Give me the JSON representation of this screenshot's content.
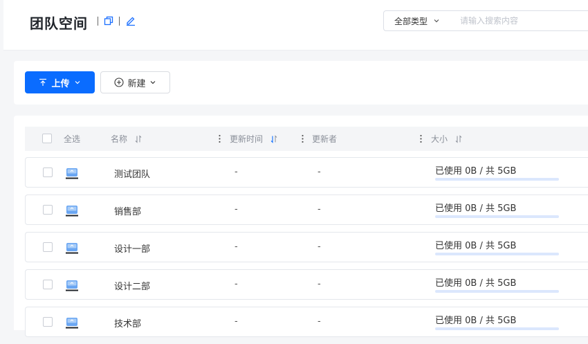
{
  "header": {
    "title": "团队空间",
    "filter": {
      "selected": "全部类型"
    },
    "search": {
      "placeholder": "请输入搜索内容",
      "value": ""
    }
  },
  "toolbar": {
    "upload_label": "上传",
    "new_label": "新建"
  },
  "table": {
    "columns": {
      "select_all": "全选",
      "name": "名称",
      "updated_time": "更新时间",
      "updater": "更新者",
      "size": "大小"
    },
    "rows": [
      {
        "name": "测试团队",
        "updated_time": "-",
        "updater": "-",
        "usage": "已使用 0B / 共 5GB",
        "used_fraction": 0
      },
      {
        "name": "销售部",
        "updated_time": "-",
        "updater": "-",
        "usage": "已使用 0B / 共 5GB",
        "used_fraction": 0
      },
      {
        "name": "设计一部",
        "updated_time": "-",
        "updater": "-",
        "usage": "已使用 0B / 共 5GB",
        "used_fraction": 0
      },
      {
        "name": "设计二部",
        "updated_time": "-",
        "updater": "-",
        "usage": "已使用 0B / 共 5GB",
        "used_fraction": 0
      },
      {
        "name": "技术部",
        "updated_time": "-",
        "updater": "-",
        "usage": "已使用 0B / 共 5GB",
        "used_fraction": 0
      }
    ]
  },
  "colors": {
    "primary": "#0a6cff",
    "usage_track": "#dbe7fd",
    "background": "#f5f6f8"
  },
  "icons": {
    "copy": "copy-icon",
    "edit": "edit-icon",
    "upload": "upload-arrow-icon",
    "new": "plus-circle-icon",
    "dropdown": "chevron-down-icon",
    "sort": "sort-icon",
    "drag": "column-drag-handle-icon",
    "space": "drive-icon"
  }
}
